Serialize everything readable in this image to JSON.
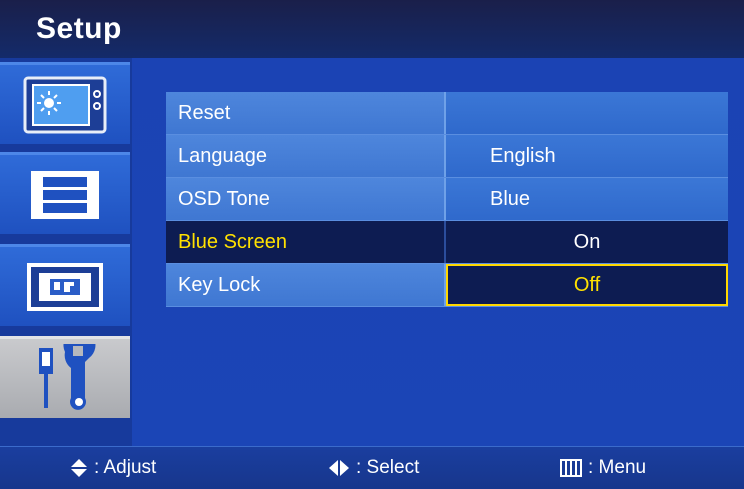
{
  "title": "Setup",
  "sidebar": {
    "items": [
      {
        "icon": "picture-brightness-icon"
      },
      {
        "icon": "film-strip-icon"
      },
      {
        "icon": "display-position-icon"
      },
      {
        "icon": "tools-setup-icon"
      }
    ],
    "active_index": 3
  },
  "menu": {
    "rows": [
      {
        "label": "Reset",
        "value": ""
      },
      {
        "label": "Language",
        "value": "English"
      },
      {
        "label": "OSD Tone",
        "value": "Blue"
      },
      {
        "label": "Blue Screen",
        "value": "On"
      },
      {
        "label": "Key Lock",
        "value": "Off"
      }
    ],
    "selected_row": "Blue Screen",
    "focused_value": "Key Lock"
  },
  "footer": {
    "adjust": ": Adjust",
    "select": ": Select",
    "menu": ": Menu"
  },
  "colors": {
    "highlight_text": "#ffe100",
    "selected_bg": "#0d1c52",
    "focus_border": "#ffd800"
  }
}
